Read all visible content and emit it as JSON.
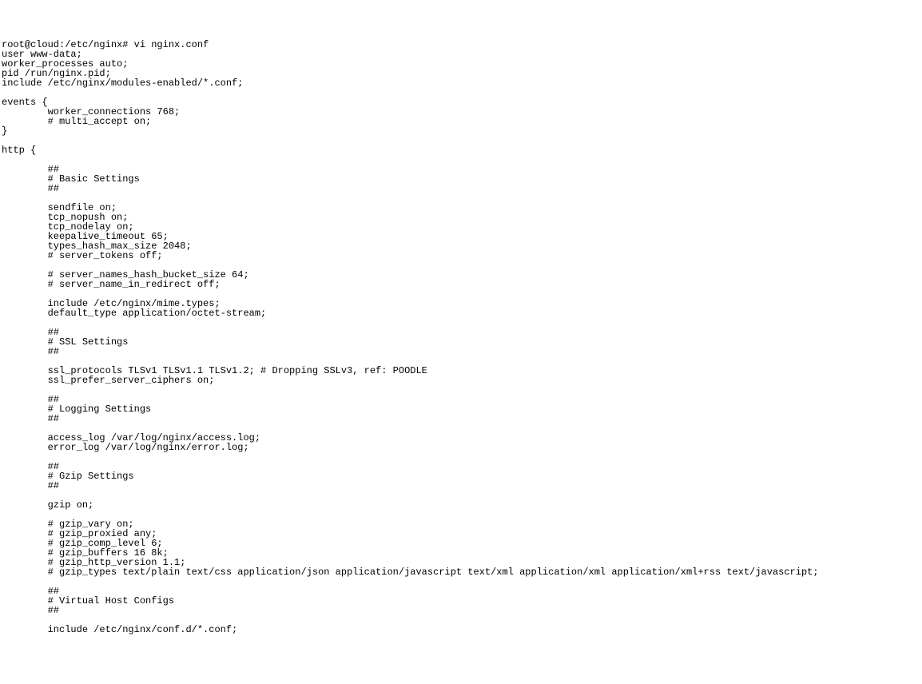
{
  "terminal": {
    "lines": [
      "root@cloud:/etc/nginx# vi nginx.conf",
      "user www-data;",
      "worker_processes auto;",
      "pid /run/nginx.pid;",
      "include /etc/nginx/modules-enabled/*.conf;",
      "",
      "events {",
      "        worker_connections 768;",
      "        # multi_accept on;",
      "}",
      "",
      "http {",
      "",
      "        ##",
      "        # Basic Settings",
      "        ##",
      "",
      "        sendfile on;",
      "        tcp_nopush on;",
      "        tcp_nodelay on;",
      "        keepalive_timeout 65;",
      "        types_hash_max_size 2048;",
      "        # server_tokens off;",
      "",
      "        # server_names_hash_bucket_size 64;",
      "        # server_name_in_redirect off;",
      "",
      "        include /etc/nginx/mime.types;",
      "        default_type application/octet-stream;",
      "",
      "        ##",
      "        # SSL Settings",
      "        ##",
      "",
      "        ssl_protocols TLSv1 TLSv1.1 TLSv1.2; # Dropping SSLv3, ref: POODLE",
      "        ssl_prefer_server_ciphers on;",
      "",
      "        ##",
      "        # Logging Settings",
      "        ##",
      "",
      "        access_log /var/log/nginx/access.log;",
      "        error_log /var/log/nginx/error.log;",
      "",
      "        ##",
      "        # Gzip Settings",
      "        ##",
      "",
      "        gzip on;",
      "",
      "        # gzip_vary on;",
      "        # gzip_proxied any;",
      "        # gzip_comp_level 6;",
      "        # gzip_buffers 16 8k;",
      "        # gzip_http_version 1.1;",
      "        # gzip_types text/plain text/css application/json application/javascript text/xml application/xml application/xml+rss text/javascript;",
      "",
      "        ##",
      "        # Virtual Host Configs",
      "        ##",
      "",
      "        include /etc/nginx/conf.d/*.conf;"
    ]
  }
}
